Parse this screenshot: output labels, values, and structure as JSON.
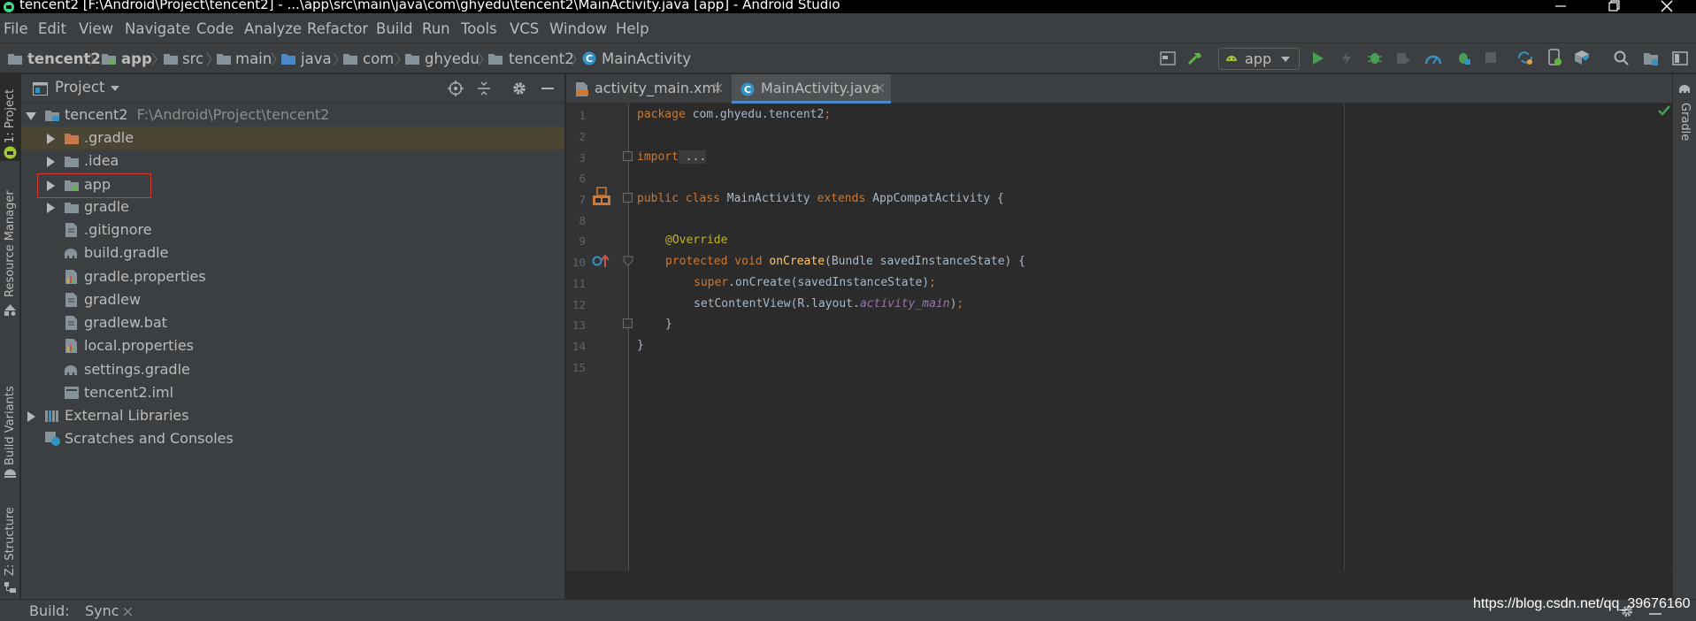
{
  "window": {
    "title": "tencent2 [F:\\Android\\Project\\tencent2] - ...\\app\\src\\main\\java\\com\\ghyedu\\tencent2\\MainActivity.java [app] - Android Studio"
  },
  "menu": [
    "File",
    "Edit",
    "View",
    "Navigate",
    "Code",
    "Analyze",
    "Refactor",
    "Build",
    "Run",
    "Tools",
    "VCS",
    "Window",
    "Help"
  ],
  "breadcrumb": [
    "tencent2",
    "app",
    "src",
    "main",
    "java",
    "com",
    "ghyedu",
    "tencent2",
    "MainActivity"
  ],
  "toolbar": {
    "run_config": "app"
  },
  "left_strip": {
    "project": "1: Project",
    "resource_manager": "Resource Manager",
    "build_variants": "Build Variants",
    "structure": "Z: Structure"
  },
  "right_strip": {
    "gradle": "Gradle"
  },
  "project_panel": {
    "title": "Project",
    "root_name": "tencent2",
    "root_path": "F:\\Android\\Project\\tencent2",
    "items": [
      ".gradle",
      ".idea",
      "app",
      "gradle",
      ".gitignore",
      "build.gradle",
      "gradle.properties",
      "gradlew",
      "gradlew.bat",
      "local.properties",
      "settings.gradle",
      "tencent2.iml"
    ],
    "external_libraries": "External Libraries",
    "scratches": "Scratches and Consoles"
  },
  "editor": {
    "tabs": [
      "activity_main.xml",
      "MainActivity.java"
    ],
    "active_tab": "MainActivity.java",
    "line_numbers": [
      "1",
      "2",
      "3",
      "6",
      "7",
      "8",
      "9",
      "10",
      "11",
      "12",
      "13",
      "14",
      "15"
    ],
    "code": {
      "l1_kw": "package",
      "l1_rest": " com.ghyedu.tencent2",
      "l1_semi": ";",
      "l3_kw": "import",
      "l3_fold": " ...",
      "l7_kw": "public class",
      "l7_name": " MainActivity ",
      "l7_ext": "extends",
      "l7_rest": " AppCompatActivity {",
      "l9_anno": "@Override",
      "l10_kw": "protected void",
      "l10_fn": " onCreate",
      "l10_rest": "(Bundle savedInstanceState) {",
      "l11_kw": "super",
      "l11_rest": ".onCreate(savedInstanceState)",
      "l11_semi": ";",
      "l12_a": "setContentView(R.layout.",
      "l12_it": "activity_main",
      "l12_b": ")",
      "l12_semi": ";",
      "l13": "}",
      "l14": "}"
    }
  },
  "bottom": {
    "build_label": "Build:",
    "sync_tab": "Sync"
  },
  "watermark": "https://blog.csdn.net/qq_39676160",
  "colors": {
    "keyword": "#cc7832",
    "annotation": "#bbb529",
    "method": "#ffc66d",
    "field": "#9876aa",
    "highlight_box": "#d4372c"
  }
}
